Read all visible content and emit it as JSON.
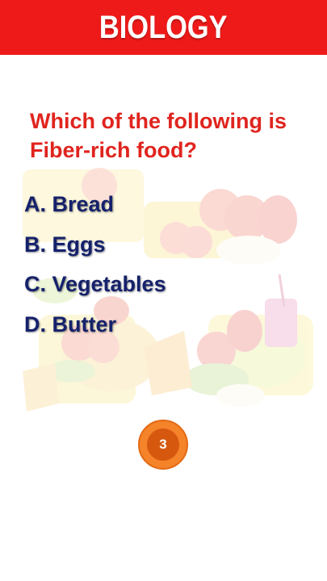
{
  "header": {
    "title": "BIOLOGY"
  },
  "question": {
    "text": "Which of the following is Fiber-rich food?"
  },
  "options": [
    {
      "label": "A. Bread"
    },
    {
      "label": "B. Eggs"
    },
    {
      "label": "C. Vegetables"
    },
    {
      "label": "D. Butter"
    }
  ],
  "timer": {
    "value": "3"
  },
  "colors": {
    "header_bg": "#ee1a1a",
    "question_text": "#e0241e",
    "option_text": "#15216b",
    "timer_ring": "#f4832a",
    "timer_center": "#d6580f"
  }
}
